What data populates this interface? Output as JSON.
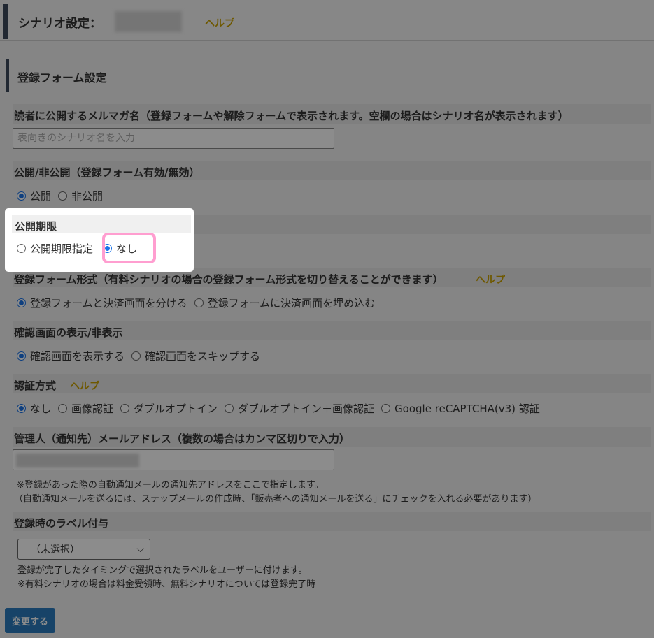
{
  "header": {
    "title": "シナリオ設定：",
    "help": "ヘルプ"
  },
  "section": {
    "title": "登録フォーム設定"
  },
  "fields": {
    "magazine_name": {
      "label": "読者に公開するメルマガ名（登録フォームや解除フォームで表示されます。空欄の場合はシナリオ名が表示されます）",
      "placeholder": "表向きのシナリオ名を入力",
      "value": ""
    },
    "public": {
      "label": "公開/非公開（登録フォーム有効/無効）",
      "options": [
        "公開",
        "非公開"
      ],
      "selected": "公開"
    },
    "period": {
      "label": "公開期限",
      "options": [
        "公開期限指定",
        "なし"
      ],
      "selected": "なし"
    },
    "form_type": {
      "label": "登録フォーム形式（有料シナリオの場合の登録フォーム形式を切り替えることができます）",
      "help": "ヘルプ",
      "options": [
        "登録フォームと決済画面を分ける",
        "登録フォームに決済画面を埋め込む"
      ],
      "selected": "登録フォームと決済画面を分ける"
    },
    "confirm": {
      "label": "確認画面の表示/非表示",
      "options": [
        "確認画面を表示する",
        "確認画面をスキップする"
      ],
      "selected": "確認画面を表示する"
    },
    "auth": {
      "label": "認証方式",
      "help": "ヘルプ",
      "options": [
        "なし",
        "画像認証",
        "ダブルオプトイン",
        "ダブルオプトイン＋画像認証",
        "Google reCAPTCHA(v3) 認証"
      ],
      "selected": "なし"
    },
    "admin_email": {
      "label": "管理人（通知先）メールアドレス（複数の場合はカンマ区切りで入力）",
      "note1": "※登録があった際の自動通知メールの通知先アドレスをここで指定します。",
      "note2": "（自動通知メールを送るには、ステップメールの作成時、「販売者への通知メールを送る」にチェックを入れる必要があります）"
    },
    "label_assign": {
      "label": "登録時のラベル付与",
      "selected": "（未選択）",
      "note1": "登録が完了したタイミングで選択されたラベルをユーザーに付けます。",
      "note2": "※有料シナリオの場合は料金受領時、無料シナリオについては登録完了時"
    }
  },
  "submit_label": "変更する",
  "colors": {
    "accent": "#3d4a5c",
    "help": "#c9a100",
    "button": "#2a7bbd",
    "highlight": "#ff9ed0",
    "radio": "#1a73e8"
  }
}
